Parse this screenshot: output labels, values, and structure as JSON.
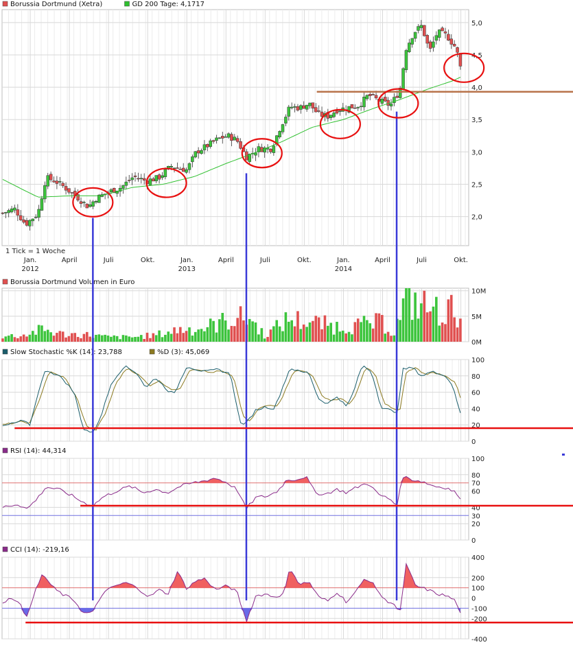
{
  "chart_data": [
    {
      "id": "price",
      "type": "candlestick",
      "legend": [
        {
          "label": "Borussia Dortmund (Xetra)",
          "color": "#e05050"
        },
        {
          "label": "GD 200 Tage: 4,1717",
          "color": "#30c030"
        }
      ],
      "note": "1 Tick = 1 Woche",
      "y_ticks": [
        "5,0",
        "4,5",
        "4,0",
        "3,5",
        "3,0",
        "2,5",
        "2,0"
      ],
      "y_tick_values": [
        5.0,
        4.5,
        4.0,
        3.5,
        3.0,
        2.5,
        2.0
      ],
      "ylim": [
        1.55,
        5.2
      ],
      "x_ticks": [
        "Jan.",
        "April",
        "Juli",
        "Okt.",
        "Jan.",
        "April",
        "Juli",
        "Okt.",
        "Jan.",
        "April",
        "Juli",
        "Okt."
      ],
      "x_tick_values": [
        2012.0,
        2012.25,
        2012.5,
        2012.75,
        2013.0,
        2013.25,
        2013.5,
        2013.75,
        2014.0,
        2014.25,
        2014.5,
        2014.75
      ],
      "year_labels": [
        "2012",
        "2013",
        "2014"
      ],
      "year_values": [
        2012.0,
        2013.0,
        2014.0
      ],
      "xlim": [
        2011.82,
        2014.8
      ],
      "close_anchors": [
        [
          2011.82,
          2.05
        ],
        [
          2011.9,
          2.12
        ],
        [
          2011.97,
          1.88
        ],
        [
          2012.05,
          2.05
        ],
        [
          2012.1,
          2.6
        ],
        [
          2012.16,
          2.55
        ],
        [
          2012.22,
          2.45
        ],
        [
          2012.3,
          2.3
        ],
        [
          2012.37,
          2.15
        ],
        [
          2012.42,
          2.28
        ],
        [
          2012.5,
          2.38
        ],
        [
          2012.58,
          2.45
        ],
        [
          2012.66,
          2.62
        ],
        [
          2012.74,
          2.55
        ],
        [
          2012.82,
          2.6
        ],
        [
          2012.9,
          2.78
        ],
        [
          2013.0,
          2.72
        ],
        [
          2013.06,
          3.0
        ],
        [
          2013.12,
          3.08
        ],
        [
          2013.2,
          3.2
        ],
        [
          2013.26,
          3.25
        ],
        [
          2013.32,
          3.18
        ],
        [
          2013.38,
          2.92
        ],
        [
          2013.46,
          3.05
        ],
        [
          2013.54,
          3.05
        ],
        [
          2013.6,
          3.4
        ],
        [
          2013.66,
          3.7
        ],
        [
          2013.72,
          3.68
        ],
        [
          2013.78,
          3.75
        ],
        [
          2013.84,
          3.58
        ],
        [
          2013.9,
          3.55
        ],
        [
          2013.96,
          3.65
        ],
        [
          2014.02,
          3.68
        ],
        [
          2014.1,
          3.72
        ],
        [
          2014.16,
          3.88
        ],
        [
          2014.22,
          3.8
        ],
        [
          2014.3,
          3.72
        ],
        [
          2014.36,
          3.95
        ],
        [
          2014.4,
          4.6
        ],
        [
          2014.45,
          4.85
        ],
        [
          2014.5,
          4.95
        ],
        [
          2014.55,
          4.55
        ],
        [
          2014.6,
          4.85
        ],
        [
          2014.66,
          4.8
        ],
        [
          2014.72,
          4.6
        ],
        [
          2014.76,
          4.17
        ]
      ],
      "ma_anchors": [
        [
          2011.82,
          2.58
        ],
        [
          2011.95,
          2.42
        ],
        [
          2012.05,
          2.3
        ],
        [
          2012.25,
          2.32
        ],
        [
          2012.45,
          2.32
        ],
        [
          2012.65,
          2.45
        ],
        [
          2012.85,
          2.5
        ],
        [
          2013.05,
          2.62
        ],
        [
          2013.25,
          2.82
        ],
        [
          2013.45,
          3.0
        ],
        [
          2013.6,
          3.15
        ],
        [
          2013.8,
          3.38
        ],
        [
          2014.0,
          3.5
        ],
        [
          2014.2,
          3.68
        ],
        [
          2014.35,
          3.8
        ],
        [
          2014.55,
          3.98
        ],
        [
          2014.7,
          4.1
        ],
        [
          2014.76,
          4.17
        ]
      ],
      "resistance_level": 3.93,
      "highlight_circles": [
        {
          "t": 2012.4,
          "v": 2.22
        },
        {
          "t": 2012.87,
          "v": 2.52
        },
        {
          "t": 2013.48,
          "v": 2.98
        },
        {
          "t": 2013.98,
          "v": 3.43
        },
        {
          "t": 2014.35,
          "v": 3.75
        },
        {
          "t": 2014.77,
          "v": 4.3
        }
      ]
    },
    {
      "id": "volume",
      "type": "bar",
      "legend": [
        {
          "label": "Borussia Dortmund Volumen in Euro",
          "color": "#e05050"
        }
      ],
      "y_ticks": [
        "10M",
        "5M",
        "0M"
      ],
      "y_tick_values": [
        10,
        5,
        0
      ],
      "ylim": [
        0,
        10.5
      ],
      "unit": "M",
      "anchors": [
        [
          2011.82,
          1.1
        ],
        [
          2011.95,
          1.2
        ],
        [
          2012.08,
          2.4
        ],
        [
          2012.2,
          1.5
        ],
        [
          2012.35,
          1.4
        ],
        [
          2012.5,
          0.9
        ],
        [
          2012.65,
          0.9
        ],
        [
          2012.8,
          1.3
        ],
        [
          2012.95,
          2.4
        ],
        [
          2013.1,
          2.6
        ],
        [
          2013.2,
          3.6
        ],
        [
          2013.3,
          4.6
        ],
        [
          2013.4,
          4.6
        ],
        [
          2013.5,
          1.2
        ],
        [
          2013.65,
          4.5
        ],
        [
          2013.8,
          3.8
        ],
        [
          2013.95,
          3.0
        ],
        [
          2014.1,
          3.2
        ],
        [
          2014.25,
          3.8
        ],
        [
          2014.32,
          1.6
        ],
        [
          2014.4,
          8.2
        ],
        [
          2014.5,
          7.2
        ],
        [
          2014.6,
          6.0
        ],
        [
          2014.7,
          6.2
        ],
        [
          2014.76,
          6.0
        ]
      ]
    },
    {
      "id": "stochastic",
      "type": "line",
      "legend": [
        {
          "label": "Slow Stochastic %K (14): 23,788",
          "color": "#1a5d6b"
        },
        {
          "label": "%D (3): 45,069",
          "color": "#8c7a20"
        }
      ],
      "y_ticks": [
        "100",
        "80",
        "60",
        "40",
        "20",
        "0"
      ],
      "y_tick_values": [
        100,
        80,
        60,
        40,
        20,
        0
      ],
      "ylim": [
        0,
        100
      ],
      "line_level": 16,
      "k_anchors": [
        [
          2011.82,
          18
        ],
        [
          2011.95,
          25
        ],
        [
          2012.0,
          20
        ],
        [
          2012.05,
          60
        ],
        [
          2012.1,
          88
        ],
        [
          2012.2,
          78
        ],
        [
          2012.28,
          60
        ],
        [
          2012.34,
          15
        ],
        [
          2012.4,
          10
        ],
        [
          2012.45,
          30
        ],
        [
          2012.52,
          72
        ],
        [
          2012.6,
          92
        ],
        [
          2012.68,
          84
        ],
        [
          2012.74,
          65
        ],
        [
          2012.8,
          78
        ],
        [
          2012.88,
          62
        ],
        [
          2012.92,
          58
        ],
        [
          2013.0,
          92
        ],
        [
          2013.06,
          88
        ],
        [
          2013.12,
          85
        ],
        [
          2013.2,
          88
        ],
        [
          2013.28,
          82
        ],
        [
          2013.34,
          22
        ],
        [
          2013.38,
          22
        ],
        [
          2013.44,
          38
        ],
        [
          2013.5,
          42
        ],
        [
          2013.56,
          40
        ],
        [
          2013.6,
          60
        ],
        [
          2013.66,
          90
        ],
        [
          2013.72,
          85
        ],
        [
          2013.78,
          84
        ],
        [
          2013.84,
          52
        ],
        [
          2013.9,
          46
        ],
        [
          2013.96,
          55
        ],
        [
          2014.02,
          42
        ],
        [
          2014.06,
          58
        ],
        [
          2014.12,
          93
        ],
        [
          2014.18,
          85
        ],
        [
          2014.24,
          42
        ],
        [
          2014.3,
          38
        ],
        [
          2014.34,
          32
        ],
        [
          2014.38,
          88
        ],
        [
          2014.44,
          90
        ],
        [
          2014.5,
          80
        ],
        [
          2014.56,
          85
        ],
        [
          2014.64,
          82
        ],
        [
          2014.7,
          68
        ],
        [
          2014.76,
          24
        ]
      ],
      "d_anchors": [
        [
          2011.82,
          20
        ],
        [
          2011.95,
          24
        ],
        [
          2012.0,
          22
        ],
        [
          2012.06,
          52
        ],
        [
          2012.12,
          85
        ],
        [
          2012.22,
          78
        ],
        [
          2012.3,
          52
        ],
        [
          2012.36,
          18
        ],
        [
          2012.42,
          14
        ],
        [
          2012.48,
          34
        ],
        [
          2012.55,
          72
        ],
        [
          2012.62,
          90
        ],
        [
          2012.7,
          80
        ],
        [
          2012.76,
          68
        ],
        [
          2012.82,
          74
        ],
        [
          2012.9,
          64
        ],
        [
          2012.95,
          62
        ],
        [
          2013.02,
          88
        ],
        [
          2013.08,
          88
        ],
        [
          2013.14,
          84
        ],
        [
          2013.22,
          86
        ],
        [
          2013.3,
          78
        ],
        [
          2013.36,
          30
        ],
        [
          2013.4,
          24
        ],
        [
          2013.46,
          40
        ],
        [
          2013.52,
          44
        ],
        [
          2013.58,
          44
        ],
        [
          2013.62,
          58
        ],
        [
          2013.68,
          86
        ],
        [
          2013.74,
          86
        ],
        [
          2013.8,
          82
        ],
        [
          2013.86,
          56
        ],
        [
          2013.92,
          50
        ],
        [
          2013.98,
          52
        ],
        [
          2014.04,
          46
        ],
        [
          2014.08,
          56
        ],
        [
          2014.14,
          90
        ],
        [
          2014.2,
          84
        ],
        [
          2014.26,
          46
        ],
        [
          2014.32,
          40
        ],
        [
          2014.36,
          36
        ],
        [
          2014.4,
          84
        ],
        [
          2014.46,
          90
        ],
        [
          2014.52,
          82
        ],
        [
          2014.58,
          84
        ],
        [
          2014.66,
          80
        ],
        [
          2014.72,
          70
        ],
        [
          2014.76,
          45
        ]
      ]
    },
    {
      "id": "rsi",
      "type": "line",
      "legend": [
        {
          "label": "RSI (14): 44,314",
          "color": "#8a2b8a"
        }
      ],
      "y_ticks": [
        "100",
        "80",
        "60",
        "40",
        "20",
        "0"
      ],
      "y_tick_values": [
        100,
        80,
        60,
        40,
        20,
        0
      ],
      "ylim": [
        0,
        100
      ],
      "ref_levels": [
        {
          "value": 70,
          "label": "70",
          "color": "#e07070"
        },
        {
          "value": 30,
          "label": "30",
          "color": "#7070e0"
        }
      ],
      "line_level": 42,
      "anchors": [
        [
          2011.82,
          40
        ],
        [
          2011.92,
          44
        ],
        [
          2011.98,
          38
        ],
        [
          2012.05,
          52
        ],
        [
          2012.1,
          65
        ],
        [
          2012.18,
          62
        ],
        [
          2012.26,
          55
        ],
        [
          2012.34,
          46
        ],
        [
          2012.4,
          42
        ],
        [
          2012.46,
          52
        ],
        [
          2012.55,
          60
        ],
        [
          2012.64,
          66
        ],
        [
          2012.72,
          58
        ],
        [
          2012.8,
          62
        ],
        [
          2012.88,
          58
        ],
        [
          2012.96,
          66
        ],
        [
          2013.04,
          70
        ],
        [
          2013.1,
          72
        ],
        [
          2013.18,
          76
        ],
        [
          2013.26,
          70
        ],
        [
          2013.32,
          62
        ],
        [
          2013.38,
          38
        ],
        [
          2013.44,
          52
        ],
        [
          2013.52,
          54
        ],
        [
          2013.58,
          60
        ],
        [
          2013.64,
          74
        ],
        [
          2013.7,
          74
        ],
        [
          2013.76,
          78
        ],
        [
          2013.82,
          58
        ],
        [
          2013.88,
          56
        ],
        [
          2013.96,
          62
        ],
        [
          2014.02,
          58
        ],
        [
          2014.1,
          66
        ],
        [
          2014.16,
          70
        ],
        [
          2014.22,
          56
        ],
        [
          2014.3,
          50
        ],
        [
          2014.34,
          42
        ],
        [
          2014.38,
          78
        ],
        [
          2014.44,
          74
        ],
        [
          2014.5,
          72
        ],
        [
          2014.58,
          66
        ],
        [
          2014.66,
          64
        ],
        [
          2014.72,
          58
        ],
        [
          2014.76,
          44
        ]
      ]
    },
    {
      "id": "cci",
      "type": "line",
      "legend": [
        {
          "label": "CCI (14): -219,16",
          "color": "#8a2b8a"
        }
      ],
      "y_ticks": [
        "400",
        "200",
        "0",
        "-200",
        "-400"
      ],
      "y_tick_values": [
        400,
        200,
        0,
        -200,
        -400
      ],
      "ylim": [
        -400,
        400
      ],
      "ref_levels": [
        {
          "value": 100,
          "label": "100",
          "color": "#e07070"
        },
        {
          "value": -100,
          "label": "-100",
          "color": "#7070e0"
        }
      ],
      "line_level": -240,
      "anchors": [
        [
          2011.82,
          -40
        ],
        [
          2011.88,
          0
        ],
        [
          2011.93,
          -30
        ],
        [
          2011.97,
          -210
        ],
        [
          2012.02,
          20
        ],
        [
          2012.08,
          240
        ],
        [
          2012.14,
          110
        ],
        [
          2012.2,
          40
        ],
        [
          2012.28,
          -20
        ],
        [
          2012.34,
          -150
        ],
        [
          2012.4,
          -140
        ],
        [
          2012.46,
          40
        ],
        [
          2012.54,
          120
        ],
        [
          2012.62,
          150
        ],
        [
          2012.7,
          80
        ],
        [
          2012.76,
          10
        ],
        [
          2012.82,
          80
        ],
        [
          2012.88,
          40
        ],
        [
          2012.94,
          260
        ],
        [
          2013.0,
          90
        ],
        [
          2013.06,
          170
        ],
        [
          2013.12,
          190
        ],
        [
          2013.18,
          80
        ],
        [
          2013.26,
          120
        ],
        [
          2013.32,
          60
        ],
        [
          2013.38,
          -230
        ],
        [
          2013.44,
          20
        ],
        [
          2013.5,
          40
        ],
        [
          2013.56,
          10
        ],
        [
          2013.62,
          40
        ],
        [
          2013.66,
          300
        ],
        [
          2013.72,
          130
        ],
        [
          2013.78,
          160
        ],
        [
          2013.84,
          10
        ],
        [
          2013.9,
          -30
        ],
        [
          2013.96,
          60
        ],
        [
          2014.02,
          -40
        ],
        [
          2014.08,
          60
        ],
        [
          2014.14,
          200
        ],
        [
          2014.2,
          120
        ],
        [
          2014.26,
          -20
        ],
        [
          2014.32,
          -50
        ],
        [
          2014.36,
          -160
        ],
        [
          2014.4,
          330
        ],
        [
          2014.46,
          120
        ],
        [
          2014.54,
          80
        ],
        [
          2014.6,
          40
        ],
        [
          2014.66,
          20
        ],
        [
          2014.72,
          -30
        ],
        [
          2014.76,
          -219
        ]
      ]
    }
  ],
  "colors": {
    "up": "#3cc43c",
    "down": "#e05050",
    "ma": "#30c030",
    "grid": "#d8d8d8",
    "frame": "#bdbdbd",
    "annotation_red": "#e81010",
    "annotation_blue": "#3a3ad8",
    "resistance": "#b8734a",
    "stoch_k": "#1a5d6b",
    "stoch_d": "#8c7a20",
    "indicator_line": "#8a2b8a",
    "fill_pos": "#f06060",
    "fill_neg": "#6a6ae8"
  },
  "divergence_times": [
    2012.4,
    2013.38,
    2014.34
  ]
}
